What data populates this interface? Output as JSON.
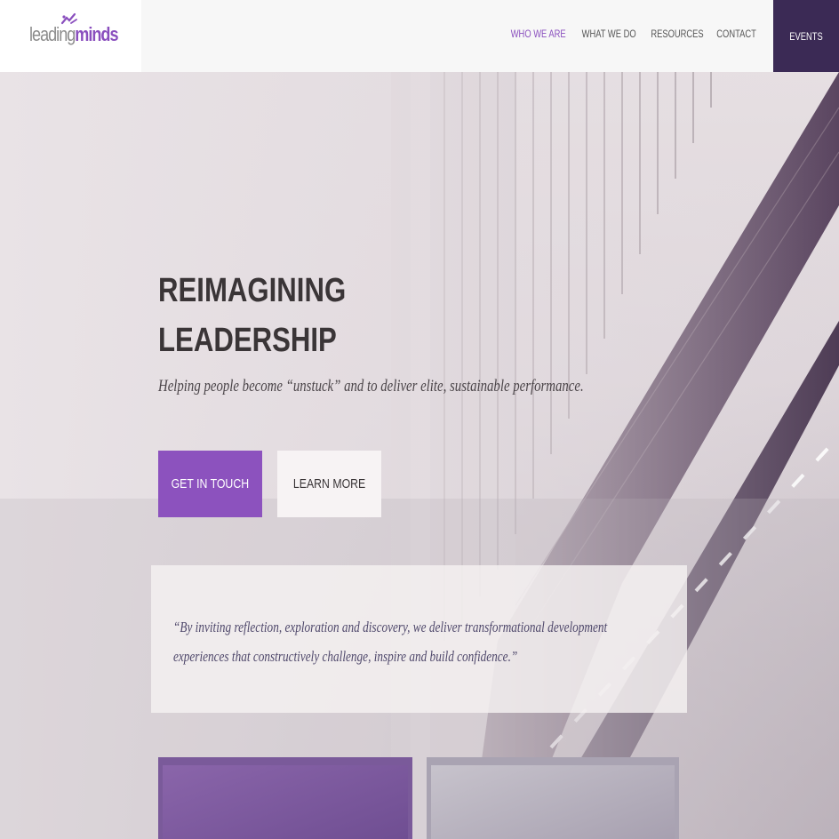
{
  "brand": {
    "logo_part1": "leading",
    "logo_part2": "minds",
    "accent": "#8c52be",
    "dark": "#3b2a55"
  },
  "nav": {
    "items": [
      {
        "label": "WHO WE ARE",
        "active": true
      },
      {
        "label": "WHAT WE DO",
        "active": false
      },
      {
        "label": "RESOURCES",
        "active": false
      },
      {
        "label": "CONTACT",
        "active": false
      }
    ],
    "events_label": "EVENTS"
  },
  "hero": {
    "title_line1": "REIMAGINING",
    "title_line2": "LEADERSHIP",
    "subtitle": "Helping people become “unstuck” and to deliver elite, sustainable performance.",
    "primary_button": "GET IN TOUCH",
    "secondary_button": "LEARN MORE"
  },
  "quote": {
    "line1": "“By inviting reflection, exploration and discovery, we deliver transformational development",
    "line2": "experiences that constructively challenge, inspire and build confidence.”"
  }
}
